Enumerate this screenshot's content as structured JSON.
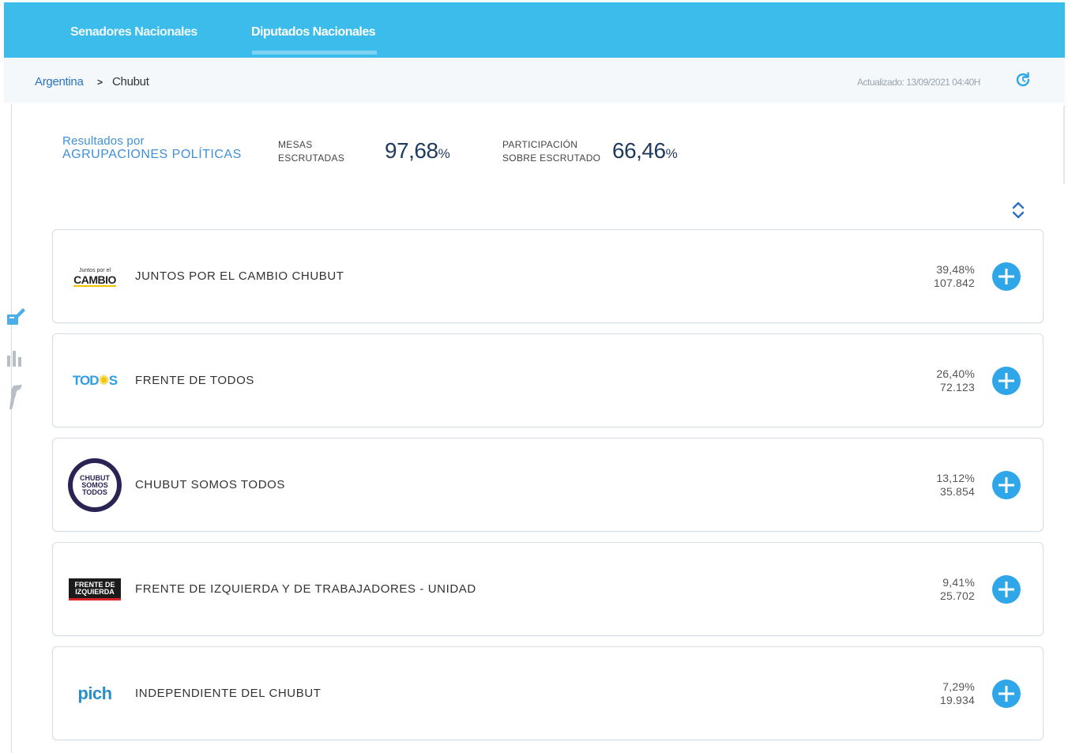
{
  "tabs": [
    {
      "label": "Senadores Nacionales"
    },
    {
      "label": "Diputados Nacionales"
    }
  ],
  "breadcrumb": {
    "root": "Argentina",
    "separator": ">",
    "current": "Chubut"
  },
  "updated": {
    "label": "Actualizado:",
    "value": "13/09/2021 04:40H"
  },
  "summary": {
    "results_line1": "Resultados por",
    "results_line2": "AGRUPACIONES POLÍTICAS",
    "mesas_line1": "MESAS",
    "mesas_line2": "ESCRUTADAS",
    "mesas_value": "97,68",
    "participacion_line1": "PARTICIPACIÓN",
    "participacion_line2": "SOBRE ESCRUTADO",
    "participacion_value": "66,46",
    "percent_sign": "%"
  },
  "parties": [
    {
      "name": "JUNTOS POR EL CAMBIO CHUBUT",
      "percent": "39,48%",
      "votes": "107.842",
      "logo_text_small": "Juntos por el",
      "logo_text": "CAMBIO"
    },
    {
      "name": "FRENTE DE TODOS",
      "percent": "26,40%",
      "votes": "72.123",
      "logo_text_a": "TOD",
      "logo_text_b": "S"
    },
    {
      "name": "CHUBUT SOMOS TODOS",
      "percent": "13,12%",
      "votes": "35.854",
      "logo_lines": [
        "CHUBUT",
        "SOMOS",
        "TODOS"
      ]
    },
    {
      "name": "FRENTE DE IZQUIERDA Y DE TRABAJADORES - UNIDAD",
      "percent": "9,41%",
      "votes": "25.702",
      "logo_lines": [
        "FRENTE DE",
        "IZQUIERDA"
      ]
    },
    {
      "name": "INDEPENDIENTE DEL CHUBUT",
      "percent": "7,29%",
      "votes": "19.934",
      "logo_text": "pich"
    }
  ],
  "colors": {
    "header": "#3bbcea",
    "accent_blue": "#2ea6e8",
    "link_blue": "#2a73c4",
    "stat_value": "#1e3b5e"
  },
  "icons": {
    "refresh": "refresh-icon",
    "collapse": "collapse-toggle-icon",
    "side": [
      "ballot-icon",
      "bar-chart-icon",
      "map-icon"
    ],
    "expand": "plus-icon"
  }
}
